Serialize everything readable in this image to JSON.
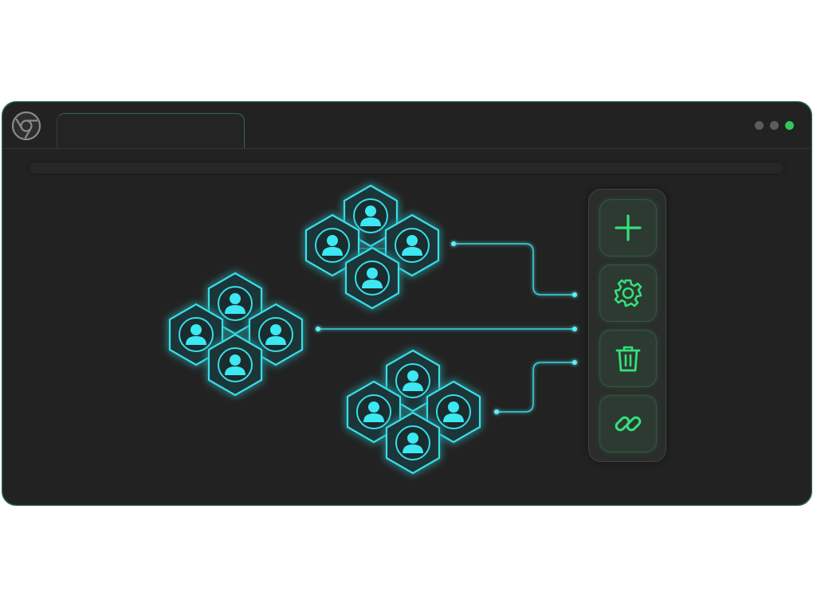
{
  "window": {
    "tab_title": "",
    "controls": [
      {
        "name": "minimize",
        "color": "#5c5c5c"
      },
      {
        "name": "maximize",
        "color": "#5c5c5c"
      },
      {
        "name": "close",
        "color": "#34c759"
      }
    ]
  },
  "colors": {
    "accent_green": "#35e07a",
    "node_cyan": "#33e6f0",
    "node_glow": "#1fc7d8",
    "connector": "#3fd3dc",
    "background": "#222222"
  },
  "groups": [
    {
      "name": "group-top",
      "members": 4,
      "icon": "user-icon"
    },
    {
      "name": "group-left",
      "members": 4,
      "icon": "user-icon"
    },
    {
      "name": "group-bottom",
      "members": 4,
      "icon": "user-icon"
    }
  ],
  "toolbar": {
    "buttons": [
      {
        "name": "add",
        "icon": "plus-icon"
      },
      {
        "name": "settings",
        "icon": "gear-icon"
      },
      {
        "name": "delete",
        "icon": "trash-icon"
      },
      {
        "name": "link",
        "icon": "link-icon"
      }
    ]
  }
}
